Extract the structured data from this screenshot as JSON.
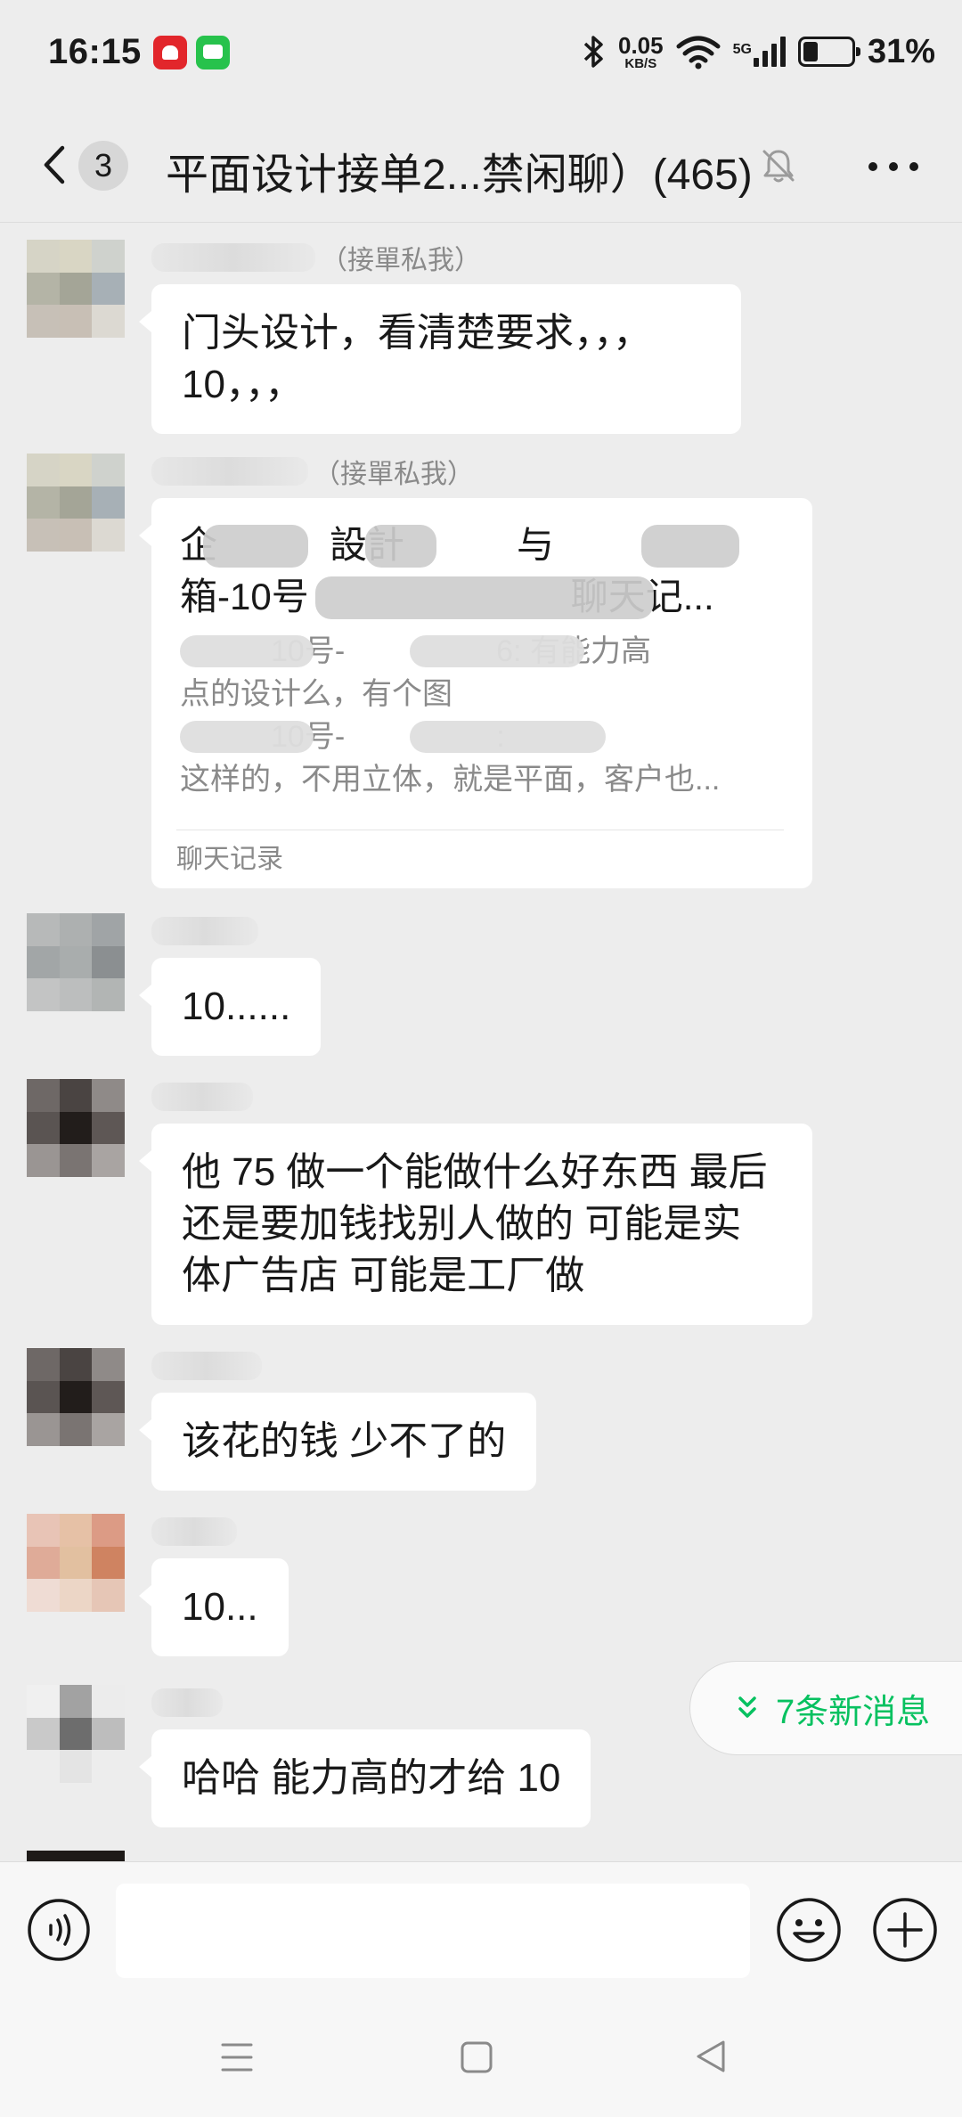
{
  "status_bar": {
    "time": "16:15",
    "net_speed_value": "0.05",
    "net_speed_unit": "KB/S",
    "network_type": "5G",
    "battery_percent": "31%",
    "icons": [
      "notification-app-icon",
      "message-app-icon",
      "bluetooth-icon",
      "wifi-icon",
      "signal-icon",
      "battery-icon"
    ]
  },
  "header": {
    "unread_count": "3",
    "title": "平面设计接单2...禁闲聊）(465)",
    "icons": [
      "back-chevron-icon",
      "mute-bell-icon",
      "more-dots-icon"
    ]
  },
  "messages": [
    {
      "sender": "（接單私我）",
      "text_lines": [
        "门头设计，看清楚要求，，，",
        "10，，，"
      ]
    },
    {
      "sender": "（接單私我）",
      "record": {
        "title_lines": [
          "企　　　設計　　　与　　　",
          "箱-10号　　　　　　　聊天记..."
        ],
        "preview_lines": [
          "　　　10号-　　　　　6: 有能力高",
          "点的设计么，有个图",
          "　　　10号-　　　　　:",
          "这样的，不用立体，就是平面，客户也..."
        ],
        "footer": "聊天记录"
      }
    },
    {
      "sender": "",
      "text_lines": [
        "10......"
      ]
    },
    {
      "sender": "",
      "text_lines": [
        "他 75 做一个能做什么好东西 最后",
        "还是要加钱找别人做的 可能是实",
        "体广告店 可能是工厂做"
      ]
    },
    {
      "sender": "",
      "text_lines": [
        "该花的钱 少不了的"
      ]
    },
    {
      "sender": "",
      "text_lines": [
        "10..."
      ]
    },
    {
      "sender": "",
      "text_lines": [
        "哈哈 能力高的才给 10"
      ]
    }
  ],
  "new_messages_pill": "7条新消息",
  "input_bar": {
    "placeholder": "",
    "icons": [
      "voice-input-icon",
      "emoji-icon",
      "plus-icon"
    ]
  },
  "nav_bar": {
    "icons": [
      "menu-icon",
      "home-icon",
      "back-triangle-icon"
    ]
  },
  "colors": {
    "background": "#ededed",
    "bubble": "#ffffff",
    "accent": "#07c160",
    "text": "#191919",
    "meta": "#8a8a8a"
  }
}
